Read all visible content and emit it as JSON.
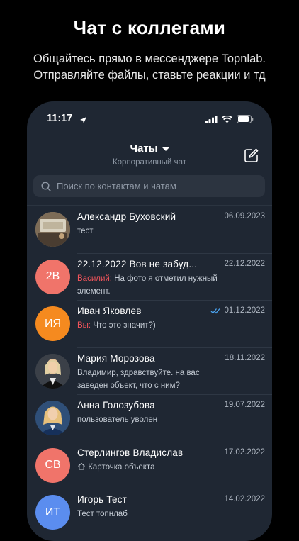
{
  "promo": {
    "title": "Чат с коллегами",
    "subtitle_line1": "Общайтесь прямо в мессенджере Topnlab.",
    "subtitle_line2": "Отправляйте файлы, ставьте реакции и тд"
  },
  "status_bar": {
    "time": "11:17",
    "icons": [
      "location-arrow-icon",
      "signal-icon",
      "wifi-icon",
      "battery-icon"
    ]
  },
  "header": {
    "title": "Чаты",
    "subtitle": "Корпоративный чат",
    "compose_icon": "compose-icon",
    "dropdown_icon": "chevron-down-icon"
  },
  "search": {
    "placeholder": "Поиск по контактам и чатам",
    "icon": "search-icon"
  },
  "chats": [
    {
      "name": "Александр Буховский",
      "date": "06.09.2023",
      "preview": "тест",
      "avatar_type": "photo",
      "avatar_color": "#8a7a66"
    },
    {
      "name": "22.12.2022 Вов не забуд...",
      "date": "22.12.2022",
      "sender": "Василий:",
      "preview": "На фото я отметил нужный элемент.",
      "avatar_type": "initials",
      "initials": "2В",
      "avatar_color": "#f0746a"
    },
    {
      "name": "Иван Яковлев",
      "date": "01.12.2022",
      "read": true,
      "sender": "Вы:",
      "preview": "Что это значит?)",
      "avatar_type": "initials",
      "initials": "ИЯ",
      "avatar_color": "#f58a1f"
    },
    {
      "name": "Мария Морозова",
      "date": "18.11.2022",
      "preview": "Владимир,  здравствуйте. на вас заведен объект,  что  с ним?",
      "avatar_type": "photo",
      "avatar_color": "#3a3f47"
    },
    {
      "name": "Анна Голозубова",
      "date": "19.07.2022",
      "preview": "пользователь уволен",
      "avatar_type": "photo",
      "avatar_color": "#2d4f7a"
    },
    {
      "name": "Стерлингов Владислав",
      "date": "17.02.2022",
      "preview_icon": "home-icon",
      "preview": "Карточка объекта",
      "avatar_type": "initials",
      "initials": "СВ",
      "avatar_color": "#f0746a"
    },
    {
      "name": "Игорь Тест",
      "date": "14.02.2022",
      "preview": "Тест топнлаб",
      "avatar_type": "initials",
      "initials": "ИТ",
      "avatar_color": "#5b8def"
    }
  ]
}
